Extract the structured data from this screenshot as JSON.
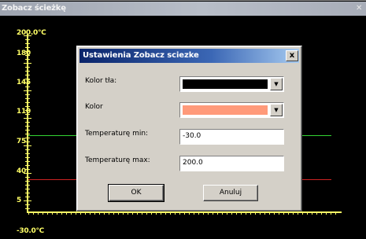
{
  "outer_window": {
    "title": "Zobacz ścieżkę",
    "close_glyph": "✕"
  },
  "axis": {
    "labels": [
      "200.0°C",
      "180",
      "145",
      "110",
      "75",
      "40",
      "5",
      "-30.0°C"
    ],
    "color": "#ffff66"
  },
  "lines": {
    "max_color": "#33d433",
    "min_color": "#cc2222"
  },
  "dialog": {
    "title": "Ustawienia Zobacz sciezke",
    "close_glyph": "x",
    "fields": {
      "background_color": {
        "label": "Kolor tła:",
        "value_color": "#000000"
      },
      "color": {
        "label": "Kolor",
        "value_color": "#ff9a7a"
      },
      "temp_min": {
        "label": "Temperaturę min:",
        "value": "-30.0"
      },
      "temp_max": {
        "label": "Temperaturę max:",
        "value": "200.0"
      }
    },
    "dropdown_glyph": "▼",
    "buttons": {
      "ok": "OK",
      "cancel": "Anuluj"
    }
  }
}
